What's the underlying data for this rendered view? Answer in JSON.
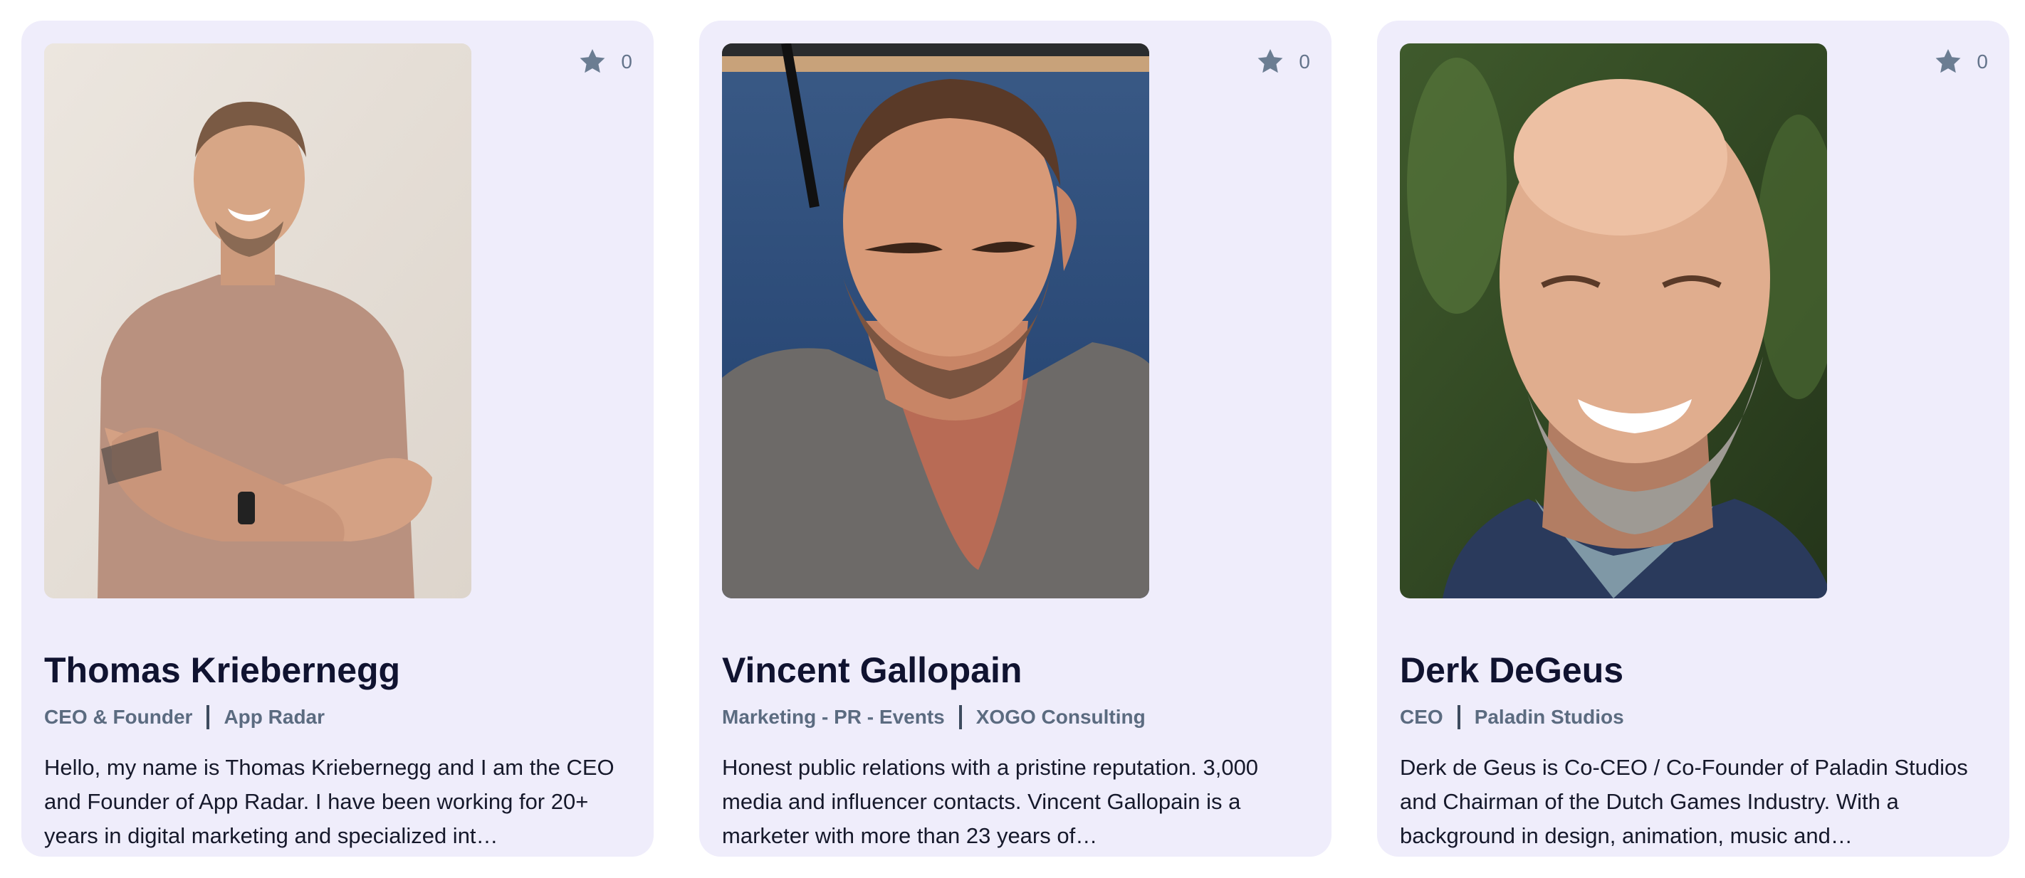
{
  "cards": [
    {
      "name": "Thomas Kriebernegg",
      "role": "CEO & Founder",
      "company": "App Radar",
      "bio": "Hello, my name is Thomas Kriebernegg and I am the CEO and Founder of App Radar. I have been working for 20+ years in digital marketing and specialized int…",
      "stars": "0",
      "star_icon": "star-icon",
      "photo_icon": "profile-photo"
    },
    {
      "name": "Vincent Gallopain",
      "role": "Marketing - PR - Events",
      "company": "XOGO Consulting",
      "bio": "Honest public relations with a pristine reputation. 3,000 media and influencer contacts. Vincent Gallopain is a marketer with more than 23 years of…",
      "stars": "0",
      "star_icon": "star-icon",
      "photo_icon": "profile-photo"
    },
    {
      "name": "Derk DeGeus",
      "role": "CEO",
      "company": "Paladin Studios",
      "bio": "Derk de Geus is Co-CEO / Co-Founder of Paladin Studios and Chairman of the Dutch Games Industry. With a background in design, animation, music and…",
      "stars": "0",
      "star_icon": "star-icon",
      "photo_icon": "profile-photo"
    }
  ],
  "colors": {
    "card_bg": "#efedfb",
    "name": "#101330",
    "meta": "#5b6b80",
    "bio": "#16192b",
    "star": "#6b7d92"
  }
}
